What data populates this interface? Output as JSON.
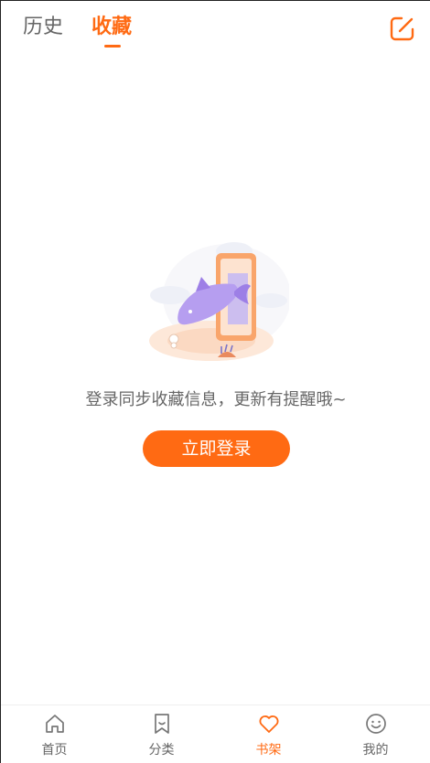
{
  "header": {
    "tabs": [
      {
        "label": "历史",
        "active": false
      },
      {
        "label": "收藏",
        "active": true
      }
    ],
    "edit_icon": "edit-icon"
  },
  "empty_state": {
    "message": "登录同步收藏信息，更新有提醒哦~",
    "login_button": "立即登录",
    "illustration": "fish-phone-illustration"
  },
  "bottom_nav": {
    "items": [
      {
        "label": "首页",
        "icon": "home-icon",
        "active": false
      },
      {
        "label": "分类",
        "icon": "bookmark-icon",
        "active": false
      },
      {
        "label": "书架",
        "icon": "heart-icon",
        "active": true
      },
      {
        "label": "我的",
        "icon": "smile-icon",
        "active": false
      }
    ]
  },
  "colors": {
    "accent": "#ff6a13",
    "text_secondary": "#666666"
  }
}
